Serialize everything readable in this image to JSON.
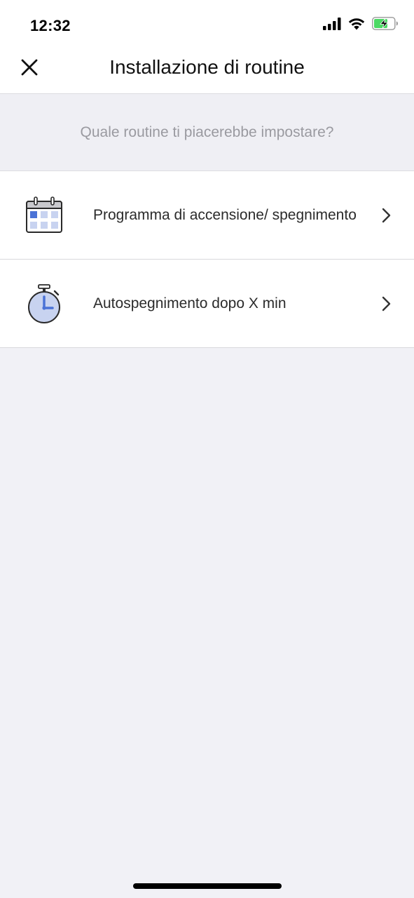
{
  "status_bar": {
    "time": "12:32",
    "icons": [
      "cellular-signal-icon",
      "wifi-icon",
      "battery-charging-icon"
    ]
  },
  "nav": {
    "title": "Installazione di routine",
    "close_icon": "close-icon"
  },
  "prompt": {
    "text": "Quale routine ti piacerebbe impostare?"
  },
  "routines": [
    {
      "label": "Programma di accensione/ spegnimento",
      "icon": "calendar-icon"
    },
    {
      "label": "Autospegnimento dopo X min",
      "icon": "stopwatch-icon"
    }
  ],
  "colors": {
    "accent": "#4a72d6",
    "background": "#f1f1f6",
    "battery_green": "#4cd964"
  }
}
